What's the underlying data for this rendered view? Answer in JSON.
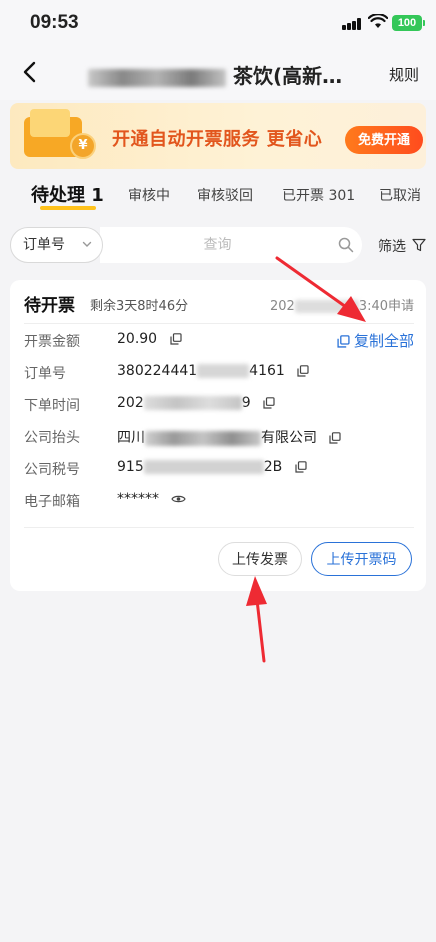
{
  "status_bar": {
    "time": "09:53",
    "battery": "100"
  },
  "nav": {
    "title_visible": "茶饮(高新…",
    "rules": "规则"
  },
  "banner": {
    "text": "开通自动开票服务 更省心",
    "button": "免费开通",
    "coin": "¥"
  },
  "tabs": [
    {
      "label": "待处理 1",
      "active": true
    },
    {
      "label": "审核中",
      "active": false
    },
    {
      "label": "审核驳回",
      "active": false
    },
    {
      "label": "已开票 301",
      "active": false
    },
    {
      "label": "已取消",
      "active": false
    }
  ],
  "search": {
    "select_value": "订单号",
    "placeholder": "查询",
    "filter": "筛选"
  },
  "card": {
    "status": "待开票",
    "remaining": "剩余3天8时46分",
    "time_prefix": "202",
    "time_suffix": "3:40申请",
    "copy_all": "复制全部",
    "fields": [
      {
        "label": "开票金额",
        "value_a": "20.90",
        "value_b": ""
      },
      {
        "label": "订单号",
        "value_a": "380224441",
        "value_b": "4161"
      },
      {
        "label": "下单时间",
        "value_a": "202",
        "value_b": "9"
      },
      {
        "label": "公司抬头",
        "value_a": "四川",
        "value_b": "有限公司"
      },
      {
        "label": "公司税号",
        "value_a": "915",
        "value_b": "2B"
      },
      {
        "label": "电子邮箱",
        "value_a": "******",
        "value_b": ""
      }
    ],
    "btn_upload_invoice": "上传发票",
    "btn_upload_code": "上传开票码"
  }
}
